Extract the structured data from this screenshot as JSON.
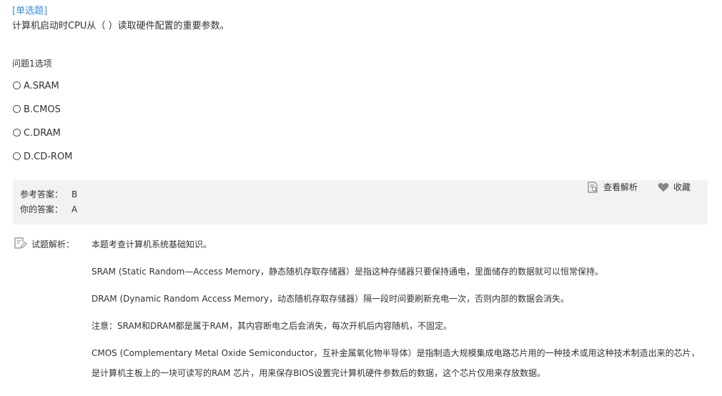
{
  "question": {
    "type_label": "[单选题]",
    "text": "计算机启动时CPU从（ ）读取硬件配置的重要参数。",
    "index_label": "问题1选项",
    "options": [
      {
        "label": "A.SRAM"
      },
      {
        "label": "B.CMOS"
      },
      {
        "label": "C.DRAM"
      },
      {
        "label": "D.CD-ROM"
      }
    ]
  },
  "answer": {
    "reference_label": "参考答案：",
    "reference_value": "B",
    "yours_label": "你的答案：",
    "yours_value": "A",
    "view_analysis_label": "查看解析",
    "favorite_label": "收藏"
  },
  "explanation": {
    "heading": "试题解析：",
    "paragraphs": [
      "本题考查计算机系统基础知识。",
      "SRAM (Static Random—Access Memory，静态随机存取存储器）是指这种存储器只要保持通电，里面储存的数据就可以恒常保持。",
      "DRAM (Dynamic Random Access Memory，动态随机存取存储器）隔一段时间要刷新充电一次，否则内部的数据会消失。",
      "注意：SRAM和DRAM都是属于RAM，其内容断电之后会消失，每次开机后内容随机，不固定。",
      "CMOS (Complementary Metal Oxide Semiconductor，互补金属氧化物半导体）是指制造大规模集成电路芯片用的一种技术或用这种技术制造出来的芯片，是计算机主板上的一块可读写的RAM 芯片，用来保存BIOS设置完计算机硬件参数后的数据，这个芯片仅用来存放数据。"
    ]
  },
  "colors": {
    "accent": "#3a8ee6",
    "text": "#333333",
    "panel_bg": "#f2f2f2",
    "icon": "#888888"
  },
  "icons": {
    "view_analysis": "document-search-icon",
    "favorite": "heart-icon",
    "explanation": "notepad-icon"
  }
}
